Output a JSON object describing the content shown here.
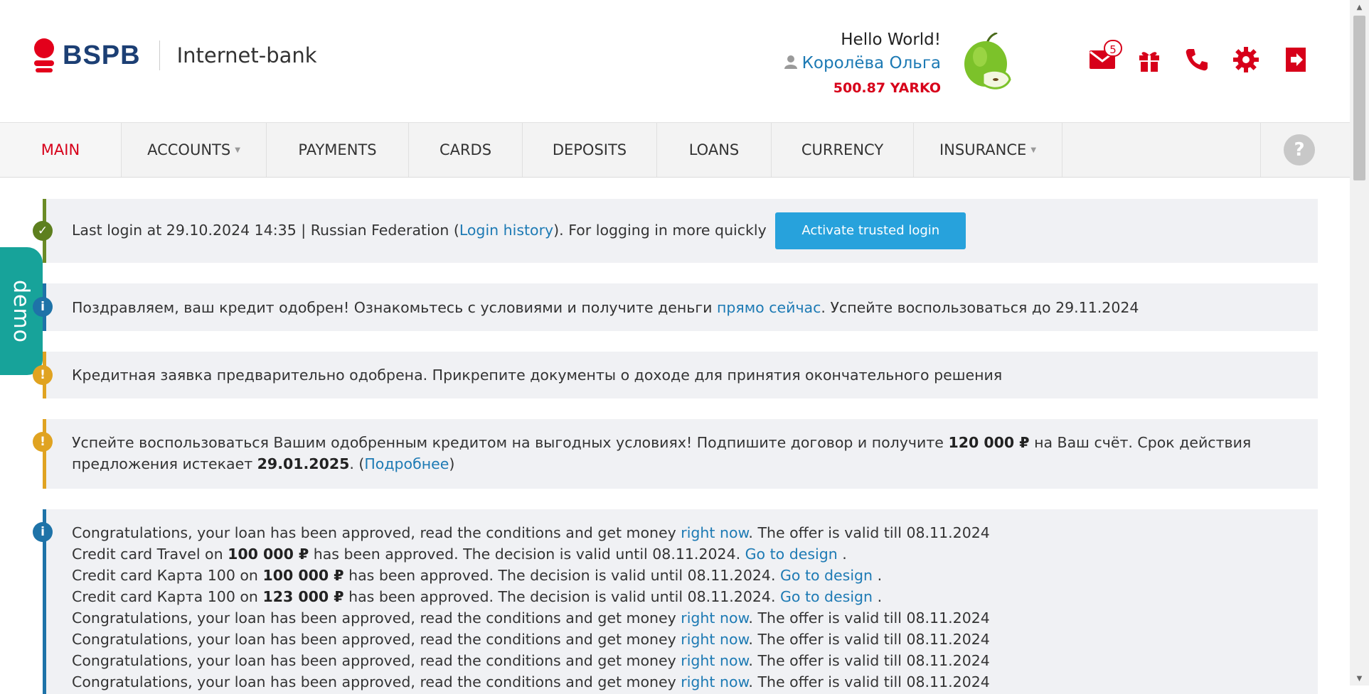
{
  "header": {
    "logo_text": "BSPB",
    "logo_subtitle": "Internet-bank",
    "greeting": "Hello World!",
    "user_name": "Королёва Ольга",
    "balance": "500.87 YARKO",
    "mail_count": "5",
    "icons": [
      "mail-icon",
      "gift-icon",
      "phone-icon",
      "settings-icon",
      "logout-icon"
    ]
  },
  "nav": {
    "items": [
      {
        "label": "MAIN",
        "active": true
      },
      {
        "label": "ACCOUNTS",
        "dropdown": true
      },
      {
        "label": "PAYMENTS"
      },
      {
        "label": "CARDS"
      },
      {
        "label": "DEPOSITS"
      },
      {
        "label": "LOANS"
      },
      {
        "label": "CURRENCY"
      },
      {
        "label": "INSURANCE",
        "dropdown": true
      }
    ],
    "help": "?"
  },
  "demo_tab": "demo",
  "alerts": {
    "login": {
      "text_before": "Last login at 29.10.2024 14:35 | Russian Federation (",
      "link": "Login history",
      "text_after": "). For logging in more quickly",
      "button": "Activate trusted login"
    },
    "credit_approved": {
      "text_before": "Поздравляем, ваш кредит одобрен! Ознакомьтесь с условиями и получите деньги ",
      "link": "прямо сейчас",
      "text_after": ". Успейте воспользоваться до 29.11.2024"
    },
    "preapproved": {
      "text": "Кредитная заявка предварительно одобрена. Прикрепите документы о доходе для принятия окончательного решения"
    },
    "offer": {
      "text1": "Успейте воспользоваться Вашим одобренным кредитом на выгодных условиях! Подпишите договор и получите ",
      "amount": "120 000 ₽",
      "text2": " на Ваш счёт. Срок действия предложения истекает ",
      "date": "29.01.2025",
      "text3": ". (",
      "link": "Подробнее",
      "text4": ")"
    },
    "list": {
      "lines": [
        {
          "before": "Congratulations, your loan has been approved, read the conditions and get money ",
          "link": "right now",
          "after": ". The offer is valid till 08.11.2024"
        },
        {
          "before": "Credit card Travel on ",
          "bold": "100 000 ₽",
          "mid": " has been approved. The decision is valid until 08.11.2024. ",
          "link": "Go to design",
          "after": " ."
        },
        {
          "before": "Credit card Карта 100 on ",
          "bold": "100 000 ₽",
          "mid": " has been approved. The decision is valid until 08.11.2024. ",
          "link": "Go to design",
          "after": " ."
        },
        {
          "before": "Credit card Карта 100 on ",
          "bold": "123 000 ₽",
          "mid": " has been approved. The decision is valid until 08.11.2024. ",
          "link": "Go to design",
          "after": " ."
        },
        {
          "before": "Congratulations, your loan has been approved, read the conditions and get money ",
          "link": "right now",
          "after": ". The offer is valid till 08.11.2024"
        },
        {
          "before": "Congratulations, your loan has been approved, read the conditions and get money ",
          "link": "right now",
          "after": ". The offer is valid till 08.11.2024"
        },
        {
          "before": "Congratulations, your loan has been approved, read the conditions and get money ",
          "link": "right now",
          "after": ". The offer is valid till 08.11.2024"
        },
        {
          "before": "Congratulations, your loan has been approved, read the conditions and get money ",
          "link": "right now",
          "after": ". The offer is valid till 08.11.2024"
        }
      ]
    }
  },
  "colors": {
    "brand_red": "#e3001b",
    "brand_blue": "#1c3f74",
    "link": "#1d7ab4",
    "button": "#27a2dc",
    "success": "#5d7f1e",
    "info": "#1e73a8",
    "warning": "#e0a321",
    "demo": "#17a39a"
  }
}
